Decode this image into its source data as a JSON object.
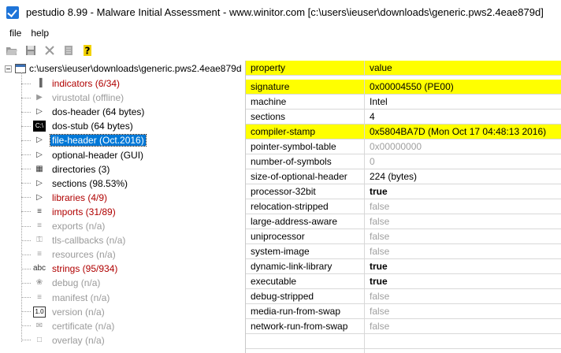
{
  "window": {
    "title": "pestudio 8.99 - Malware Initial Assessment - www.winitor.com [c:\\users\\ieuser\\downloads\\generic.pws2.4eae879d]"
  },
  "menu": [
    {
      "label": "file"
    },
    {
      "label": "help"
    }
  ],
  "toolbar": [
    {
      "name": "open-icon"
    },
    {
      "name": "save-icon"
    },
    {
      "name": "close-icon"
    },
    {
      "name": "document-icon"
    },
    {
      "name": "help-icon"
    }
  ],
  "tree": {
    "root": "c:\\users\\ieuser\\downloads\\generic.pws2.4eae879d",
    "items": [
      {
        "label": "indicators (6/34)",
        "style": "red",
        "icon": "indicators-icon",
        "glyph": "▐"
      },
      {
        "label": "virustotal (offline)",
        "style": "gray",
        "icon": "virustotal-icon",
        "glyph": "▶"
      },
      {
        "label": "dos-header (64 bytes)",
        "style": "black",
        "icon": "arrow-icon",
        "glyph": "▷"
      },
      {
        "label": "dos-stub (64 bytes)",
        "style": "black",
        "icon": "console-icon",
        "glyph": "C:\\"
      },
      {
        "label": "file-header (Oct.2016)",
        "style": "black",
        "icon": "arrow-icon",
        "glyph": "▷",
        "selected": true
      },
      {
        "label": "optional-header (GUI)",
        "style": "black",
        "icon": "arrow-icon",
        "glyph": "▷"
      },
      {
        "label": "directories (3)",
        "style": "black",
        "icon": "directories-icon",
        "glyph": "▦"
      },
      {
        "label": "sections (98.53%)",
        "style": "black",
        "icon": "arrow-icon",
        "glyph": "▷"
      },
      {
        "label": "libraries (4/9)",
        "style": "red",
        "icon": "arrow-icon",
        "glyph": "▷"
      },
      {
        "label": "imports (31/89)",
        "style": "red",
        "icon": "imports-icon",
        "glyph": "≡"
      },
      {
        "label": "exports (n/a)",
        "style": "gray",
        "icon": "exports-icon",
        "glyph": "≡"
      },
      {
        "label": "tls-callbacks (n/a)",
        "style": "gray",
        "icon": "key-icon",
        "glyph": "⚿"
      },
      {
        "label": "resources (n/a)",
        "style": "gray",
        "icon": "resources-icon",
        "glyph": "≡"
      },
      {
        "label": "strings (95/934)",
        "style": "red",
        "icon": "strings-icon",
        "glyph": "abc"
      },
      {
        "label": "debug (n/a)",
        "style": "gray",
        "icon": "bug-icon",
        "glyph": "❀"
      },
      {
        "label": "manifest (n/a)",
        "style": "gray",
        "icon": "manifest-icon",
        "glyph": "≡"
      },
      {
        "label": "version (n/a)",
        "style": "gray",
        "icon": "version-icon",
        "glyph": "1.0"
      },
      {
        "label": "certificate (n/a)",
        "style": "gray",
        "icon": "certificate-icon",
        "glyph": "✉"
      },
      {
        "label": "overlay (n/a)",
        "style": "gray",
        "icon": "overlay-icon",
        "glyph": "□"
      }
    ]
  },
  "table": {
    "header": {
      "property": "property",
      "value": "value"
    },
    "rows": [
      {
        "property": "signature",
        "value": "0x00004550 (PE00)",
        "highlight": true,
        "style": "normal"
      },
      {
        "property": "machine",
        "value": "Intel",
        "highlight": false,
        "style": "normal"
      },
      {
        "property": "sections",
        "value": "4",
        "highlight": false,
        "style": "normal"
      },
      {
        "property": "compiler-stamp",
        "value": "0x5804BA7D (Mon Oct 17 04:48:13 2016)",
        "highlight": true,
        "style": "normal"
      },
      {
        "property": "pointer-symbol-table",
        "value": "0x00000000",
        "highlight": false,
        "style": "gray"
      },
      {
        "property": "number-of-symbols",
        "value": "0",
        "highlight": false,
        "style": "gray"
      },
      {
        "property": "size-of-optional-header",
        "value": "224 (bytes)",
        "highlight": false,
        "style": "normal"
      },
      {
        "property": "processor-32bit",
        "value": "true",
        "highlight": false,
        "style": "bold"
      },
      {
        "property": "relocation-stripped",
        "value": "false",
        "highlight": false,
        "style": "gray"
      },
      {
        "property": "large-address-aware",
        "value": "false",
        "highlight": false,
        "style": "gray"
      },
      {
        "property": "uniprocessor",
        "value": "false",
        "highlight": false,
        "style": "gray"
      },
      {
        "property": "system-image",
        "value": "false",
        "highlight": false,
        "style": "gray"
      },
      {
        "property": "dynamic-link-library",
        "value": "true",
        "highlight": false,
        "style": "bold"
      },
      {
        "property": "executable",
        "value": "true",
        "highlight": false,
        "style": "bold"
      },
      {
        "property": "debug-stripped",
        "value": "false",
        "highlight": false,
        "style": "gray"
      },
      {
        "property": "media-run-from-swap",
        "value": "false",
        "highlight": false,
        "style": "gray"
      },
      {
        "property": "network-run-from-swap",
        "value": "false",
        "highlight": false,
        "style": "gray"
      },
      {
        "property": "",
        "value": "",
        "highlight": false,
        "style": "normal"
      },
      {
        "property": "",
        "value": "",
        "highlight": false,
        "style": "normal"
      }
    ]
  },
  "colors": {
    "highlight": "#ffff00",
    "selection": "#0078d7",
    "red_text": "#b00000",
    "gray_text": "#9a9a9a"
  }
}
